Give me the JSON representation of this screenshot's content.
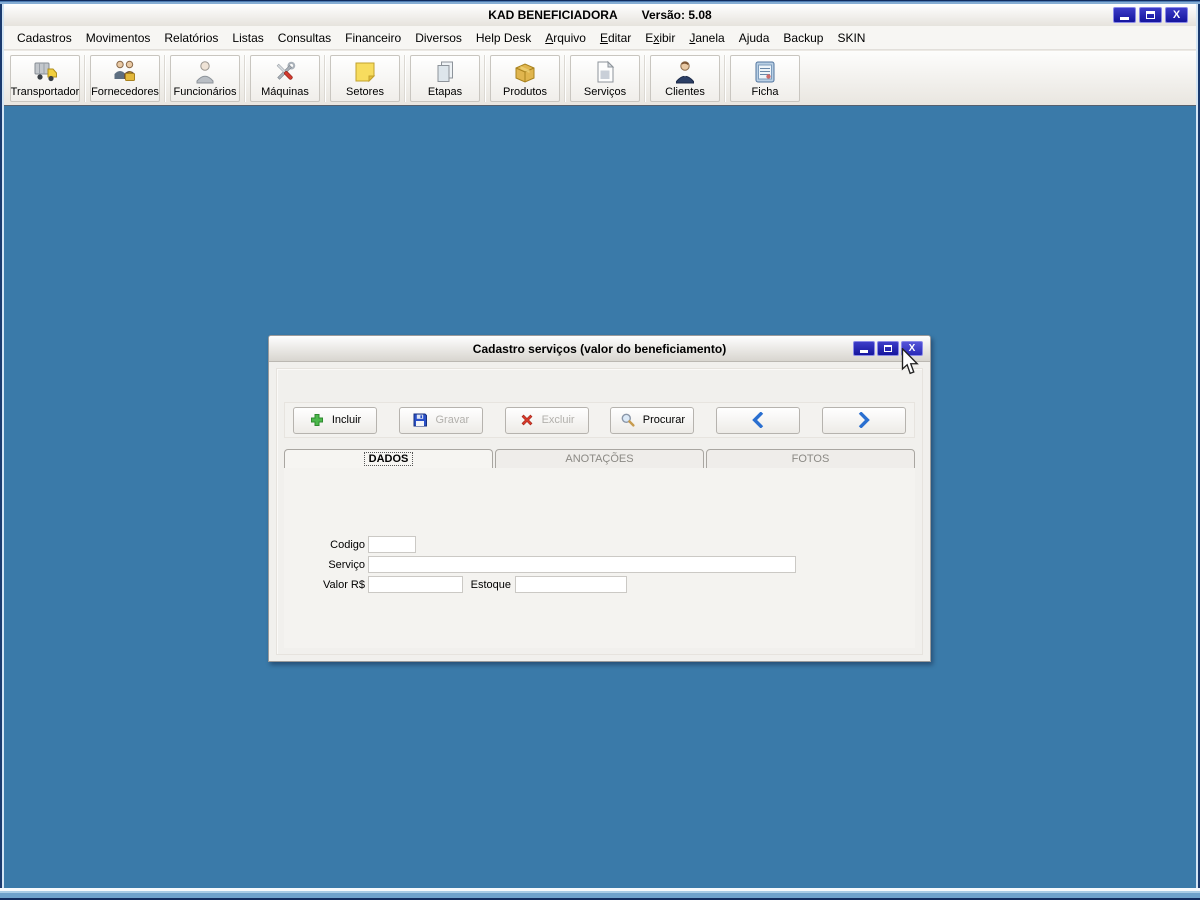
{
  "app": {
    "title": "KAD BENEFICIADORA",
    "version": "Versão: 5.08",
    "controls": {
      "minimize": "minimize",
      "maximize": "maximize",
      "close": "X"
    }
  },
  "colors": {
    "mdi_background": "#3a7aa9",
    "control_button_blue": "#15159d",
    "frame_navy": "#122c5e",
    "disabled_text": "#b2b0ac"
  },
  "menu": {
    "items": [
      {
        "label": "Cadastros",
        "key_index": -1
      },
      {
        "label": "Movimentos",
        "key_index": -1
      },
      {
        "label": "Relatórios",
        "key_index": -1
      },
      {
        "label": "Listas",
        "key_index": -1
      },
      {
        "label": "Consultas",
        "key_index": -1
      },
      {
        "label": "Financeiro",
        "key_index": -1
      },
      {
        "label": "Diversos",
        "key_index": -1
      },
      {
        "label": "Help Desk",
        "key_index": -1
      },
      {
        "label": "Arquivo",
        "key_index": 0
      },
      {
        "label": "Editar",
        "key_index": 0
      },
      {
        "label": "Exibir",
        "key_index": 1
      },
      {
        "label": "Janela",
        "key_index": 0
      },
      {
        "label": "Ajuda",
        "key_index": -1
      },
      {
        "label": "Backup",
        "key_index": -1
      },
      {
        "label": "SKIN",
        "key_index": -1
      }
    ]
  },
  "toolbar": {
    "buttons": [
      {
        "label": "Transportador",
        "icon": "truck-icon"
      },
      {
        "label": "Fornecedores",
        "icon": "suppliers-icon"
      },
      {
        "label": "Funcionários",
        "icon": "employee-icon"
      },
      {
        "label": "Máquinas",
        "icon": "tools-icon"
      },
      {
        "label": "Setores",
        "icon": "note-icon"
      },
      {
        "label": "Etapas",
        "icon": "panes-icon"
      },
      {
        "label": "Produtos",
        "icon": "box-icon"
      },
      {
        "label": "Serviços",
        "icon": "document-icon"
      },
      {
        "label": "Clientes",
        "icon": "client-icon"
      },
      {
        "label": "Ficha",
        "icon": "sheet-icon"
      }
    ]
  },
  "child_window": {
    "title": "Cadastro serviços (valor do beneficiamento)",
    "controls": {
      "minimize": "minimize",
      "maximize": "maximize",
      "close": "X"
    },
    "toolbar": [
      {
        "label": "Incluir",
        "icon": "plus-icon",
        "enabled": true
      },
      {
        "label": "Gravar",
        "icon": "save-icon",
        "enabled": false
      },
      {
        "label": "Excluir",
        "icon": "delete-icon",
        "enabled": false
      },
      {
        "label": "Procurar",
        "icon": "search-icon",
        "enabled": true
      },
      {
        "label": "",
        "icon": "chevron-left-icon",
        "enabled": true
      },
      {
        "label": "",
        "icon": "chevron-right-icon",
        "enabled": true
      }
    ],
    "tabs": [
      {
        "label": "DADOS",
        "active": true
      },
      {
        "label": "ANOTAÇÕES",
        "active": false
      },
      {
        "label": "FOTOS",
        "active": false
      }
    ],
    "fields": [
      {
        "label": "Codigo",
        "value": ""
      },
      {
        "label": "Serviço",
        "value": ""
      },
      {
        "label": "Valor R$",
        "value": ""
      },
      {
        "label": "Estoque",
        "value": ""
      }
    ]
  }
}
